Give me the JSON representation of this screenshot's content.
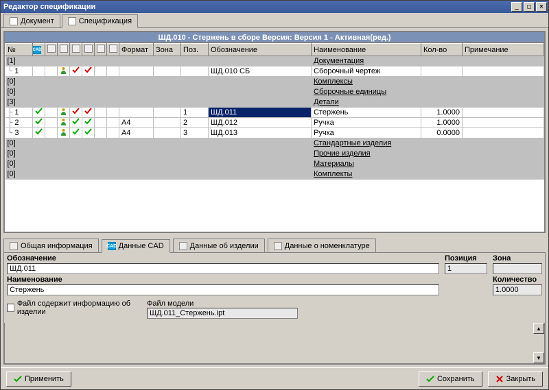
{
  "window": {
    "title": "Редактор спецификации"
  },
  "main_tabs": [
    {
      "label": "Документ",
      "icon": "doc"
    },
    {
      "label": "Спецификация",
      "icon": "spec"
    }
  ],
  "banner": "ШД.010 - Стержень в сборе Версия: Версия 1 -   Активная(ред.)",
  "columns": {
    "num": "№",
    "format": "Формат",
    "zone": "Зона",
    "pos": "Поз.",
    "designation": "Обозначение",
    "name": "Наименование",
    "qty": "Кол-во",
    "note": "Примечание"
  },
  "rows": [
    {
      "type": "section",
      "num": "[1]",
      "name": "Документация"
    },
    {
      "type": "item",
      "tree": "└",
      "num": "1",
      "icons": {
        "3": "person",
        "4": "red",
        "5": "red"
      },
      "designation": "ШД.010 СБ",
      "name": "Сборочный чертеж"
    },
    {
      "type": "section",
      "num": "[0]",
      "name": "Комплексы"
    },
    {
      "type": "section",
      "num": "[0]",
      "name": "Сборочные единицы"
    },
    {
      "type": "section",
      "num": "[3]",
      "name": "Детали"
    },
    {
      "type": "item",
      "tree": "├",
      "num": "1",
      "icons": {
        "1": "green",
        "3": "person",
        "4": "red",
        "5": "red"
      },
      "pos": "1",
      "designation": "ШД.011",
      "sel": true,
      "name": "Стержень",
      "qty": "1.0000"
    },
    {
      "type": "item",
      "tree": "├",
      "num": "2",
      "icons": {
        "1": "green",
        "3": "person",
        "4": "green",
        "5": "green"
      },
      "format": "A4",
      "pos": "2",
      "designation": "ШД.012",
      "name": "Ручка",
      "qty": "1.0000"
    },
    {
      "type": "item",
      "tree": "└",
      "num": "3",
      "icons": {
        "1": "green",
        "3": "person",
        "4": "green",
        "5": "green"
      },
      "format": "A4",
      "pos": "3",
      "designation": "ШД.013",
      "name": "Ручка",
      "qty": "0.0000"
    },
    {
      "type": "section",
      "num": "[0]",
      "name": "Стандартные изделия"
    },
    {
      "type": "section",
      "num": "[0]",
      "name": "Прочие изделия"
    },
    {
      "type": "section",
      "num": "[0]",
      "name": "Материалы"
    },
    {
      "type": "section",
      "num": "[0]",
      "name": "Комплекты"
    }
  ],
  "bottom_tabs": [
    {
      "label": "Общая информация",
      "icon": "tab"
    },
    {
      "label": "Данные  CAD",
      "icon": "cad"
    },
    {
      "label": "Данные об изделии",
      "icon": "tab"
    },
    {
      "label": "Данные о номенклатуре",
      "icon": "tab"
    }
  ],
  "form": {
    "designation_label": "Обозначение",
    "designation": "ШД.011",
    "name_label": "Наименование",
    "name": "Стержень",
    "position_label": "Позиция",
    "position": "1",
    "zone_label": "Зона",
    "zone": "",
    "qty_label": "Количество",
    "qty": "1.0000",
    "file_contains_label": "Файл содержит информацию об изделии",
    "model_file_label": "Файл модели",
    "model_file": "ШД.011_Стержень.ipt"
  },
  "footer": {
    "apply": "Применить",
    "save": "Сохранить",
    "close": "Закрыть"
  }
}
